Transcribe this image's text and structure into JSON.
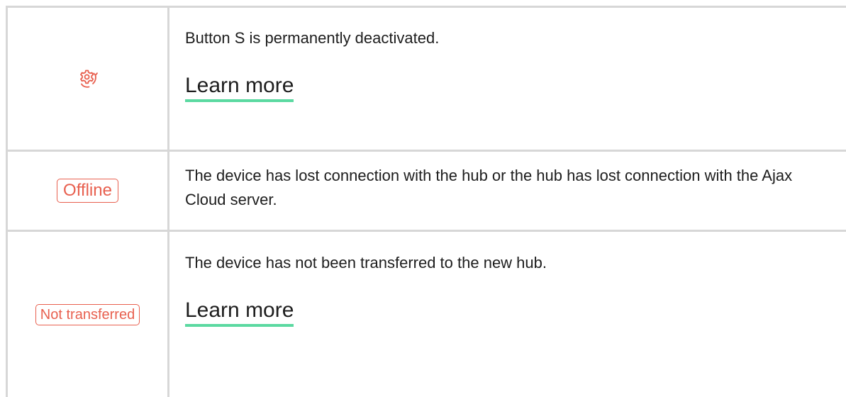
{
  "colors": {
    "accent_red": "#e8604f",
    "underline_green": "#5bd9a1",
    "border_gray": "#d7d7d7",
    "text": "#1d1d1d"
  },
  "rows": [
    {
      "icon": "gear-arrow-icon",
      "description": "Button S is permanently deactivated.",
      "link_label": "Learn more"
    },
    {
      "badge": "Offline",
      "description": "The device has lost connection with the hub or the hub has lost connection with the Ajax Cloud server."
    },
    {
      "badge": "Not transferred",
      "description": "The device has not been transferred to the new hub.",
      "link_label": "Learn more"
    }
  ]
}
